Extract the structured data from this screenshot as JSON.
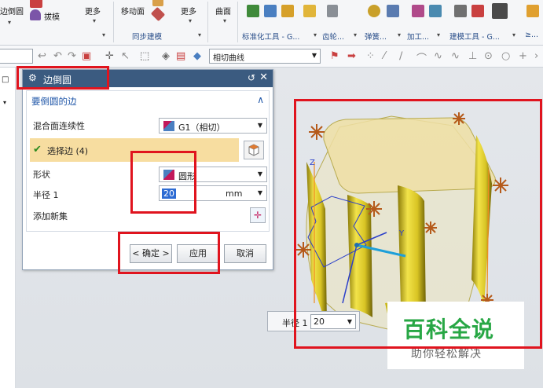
{
  "ribbon": {
    "edge_blend_label": "边倒圆",
    "draft_label": "拔模",
    "more1_label": "更多",
    "move_face_label": "移动面",
    "more2_label": "更多",
    "surface_label": "曲面",
    "sync_group_label": "同步建模",
    "std_tools_group_label": "标准化工具 - G...",
    "gear_group_label": "齿轮...",
    "spring_group_label": "弹簧...",
    "machining_group_label": "加工...",
    "modeling_group_label": "建模工具 - G...",
    "extra_group_label": "≥..."
  },
  "toolbar2": {
    "curve_select_value": "相切曲线"
  },
  "dialog": {
    "title": "边倒圆",
    "section_title": "要倒圆的边",
    "continuity_label": "混合面连续性",
    "continuity_value": "G1（相切）",
    "select_edge_label": "选择边 (4)",
    "shape_label": "形状",
    "shape_value": "圆形",
    "radius_label": "半径 1",
    "radius_value": "20",
    "radius_unit": "mm",
    "add_set_label": "添加新集",
    "ok_label": "< 确定 >",
    "apply_label": "应用",
    "cancel_label": "取消"
  },
  "floating": {
    "radius_label": "半径 1",
    "radius_value": "20"
  },
  "watermark": {
    "title": "百科全说",
    "subtitle": "助你轻松解决"
  },
  "colors": {
    "dialog_title_bg": "#3b5b80",
    "selected_row_bg": "#f7dda0",
    "highlight_red": "#e0141e",
    "part_yellow": "#d6c52a",
    "watermark_green": "#28a745"
  }
}
